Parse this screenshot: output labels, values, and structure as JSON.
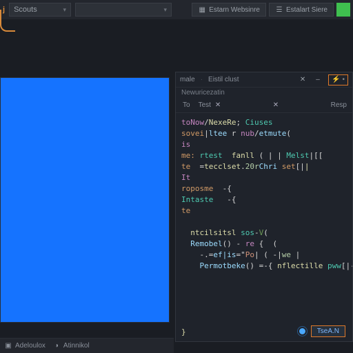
{
  "topbar": {
    "left_label": "j",
    "dropdown_label": "Scouts",
    "btn1": "Estarn Websinre",
    "btn2": "Estalart Siere"
  },
  "preview": {
    "color": "#1573ff"
  },
  "code": {
    "header_tab1": "male",
    "header_tab2": "Eistil clust",
    "subheader": "Newuricezatin",
    "tab1": "To",
    "tab2": "Test",
    "tab3": "Resp",
    "lines": [
      {
        "segs": [
          {
            "t": "toNow",
            "c": "tok-kw"
          },
          {
            "t": "/",
            "c": "tok-op"
          },
          {
            "t": "NexeRe",
            "c": "tok-fn"
          },
          {
            "t": "; ",
            "c": "tok-op"
          },
          {
            "t": "Ciuses",
            "c": "tok-type"
          }
        ]
      },
      {
        "segs": [
          {
            "t": "sovei",
            "c": "tok-warn"
          },
          {
            "t": "|",
            "c": "tok-op"
          },
          {
            "t": "ltee",
            "c": "tok-var"
          },
          {
            "t": " r ",
            "c": "tok-op"
          },
          {
            "t": "nub",
            "c": "tok-kw"
          },
          {
            "t": "/",
            "c": "tok-op"
          },
          {
            "t": "etmute",
            "c": "tok-var"
          },
          {
            "t": "(",
            "c": "tok-op"
          }
        ]
      },
      {
        "segs": [
          {
            "t": "is",
            "c": "tok-kw"
          }
        ]
      },
      {
        "segs": [
          {
            "t": "me:",
            "c": "tok-warn"
          },
          {
            "t": " ",
            "c": ""
          },
          {
            "t": "rtest",
            "c": "tok-type"
          },
          {
            "t": "  ",
            "c": ""
          },
          {
            "t": "fanll",
            "c": "tok-fn"
          },
          {
            "t": " ( | | ",
            "c": "tok-op"
          },
          {
            "t": "Melst",
            "c": "tok-type"
          },
          {
            "t": "|[[",
            "c": "tok-op"
          }
        ]
      },
      {
        "segs": [
          {
            "t": "te",
            "c": "tok-warn"
          },
          {
            "t": "  =",
            "c": "tok-op"
          },
          {
            "t": "tecclset",
            "c": "tok-fn"
          },
          {
            "t": ".",
            "c": "tok-op"
          },
          {
            "t": "20r",
            "c": "tok-num"
          },
          {
            "t": "Chri",
            "c": "tok-var"
          },
          {
            "t": " ",
            "c": ""
          },
          {
            "t": "set",
            "c": "tok-warn"
          },
          {
            "t": "[|",
            "c": "tok-op"
          },
          {
            "t": "|",
            "c": "tok-fn"
          }
        ]
      },
      {
        "segs": [
          {
            "t": "It",
            "c": "tok-kw"
          }
        ]
      },
      {
        "segs": [
          {
            "t": "roposme",
            "c": "tok-warn"
          },
          {
            "t": "  -{",
            "c": "tok-op"
          }
        ]
      },
      {
        "segs": [
          {
            "t": "Intaste",
            "c": "tok-type"
          },
          {
            "t": "   -{",
            "c": "tok-op"
          }
        ]
      },
      {
        "segs": [
          {
            "t": "te",
            "c": "tok-warn"
          }
        ]
      },
      {
        "segs": [
          {
            "t": "",
            "c": ""
          }
        ]
      },
      {
        "segs": [
          {
            "t": "  ",
            "c": ""
          },
          {
            "t": "ntcilsitsl",
            "c": "tok-fn"
          },
          {
            "t": " ",
            "c": ""
          },
          {
            "t": "sos",
            "c": "tok-type"
          },
          {
            "t": "-",
            "c": "tok-op"
          },
          {
            "t": "V",
            "c": "tok-comm"
          },
          {
            "t": "(",
            "c": "tok-op"
          }
        ]
      },
      {
        "segs": [
          {
            "t": "  ",
            "c": ""
          },
          {
            "t": "Remobel",
            "c": "tok-var"
          },
          {
            "t": "() - ",
            "c": "tok-op"
          },
          {
            "t": "re",
            "c": "tok-kw"
          },
          {
            "t": " {  (",
            "c": "tok-op"
          }
        ]
      },
      {
        "segs": [
          {
            "t": "    -.=",
            "c": "tok-op"
          },
          {
            "t": "ef|is",
            "c": "tok-var"
          },
          {
            "t": "=\"",
            "c": "tok-op"
          },
          {
            "t": "Po",
            "c": "tok-str"
          },
          {
            "t": "| ( -|",
            "c": "tok-op"
          },
          {
            "t": "we",
            "c": "tok-num"
          },
          {
            "t": " |",
            "c": "tok-op"
          }
        ]
      },
      {
        "segs": [
          {
            "t": "    ",
            "c": ""
          },
          {
            "t": "Permotbeke",
            "c": "tok-var"
          },
          {
            "t": "() =-{ ",
            "c": "tok-op"
          },
          {
            "t": "nflectille",
            "c": "tok-fn"
          },
          {
            "t": " ",
            "c": ""
          },
          {
            "t": "pww",
            "c": "tok-type"
          },
          {
            "t": "[|-{ ",
            "c": "tok-op"
          },
          {
            "t": ">",
            "c": "tok-fn"
          }
        ]
      },
      {
        "segs": [
          {
            "t": "",
            "c": ""
          }
        ]
      },
      {
        "segs": [
          {
            "t": "",
            "c": ""
          }
        ]
      },
      {
        "segs": [
          {
            "t": "",
            "c": ""
          }
        ]
      },
      {
        "segs": [
          {
            "t": "",
            "c": ""
          }
        ]
      },
      {
        "segs": [
          {
            "t": "",
            "c": ""
          }
        ]
      },
      {
        "segs": [
          {
            "t": "}",
            "c": "tok-fn"
          }
        ]
      }
    ],
    "run_label": "TseA.N"
  },
  "bottom": {
    "item1": "Adeloulox",
    "item2": "Atinnikol"
  }
}
